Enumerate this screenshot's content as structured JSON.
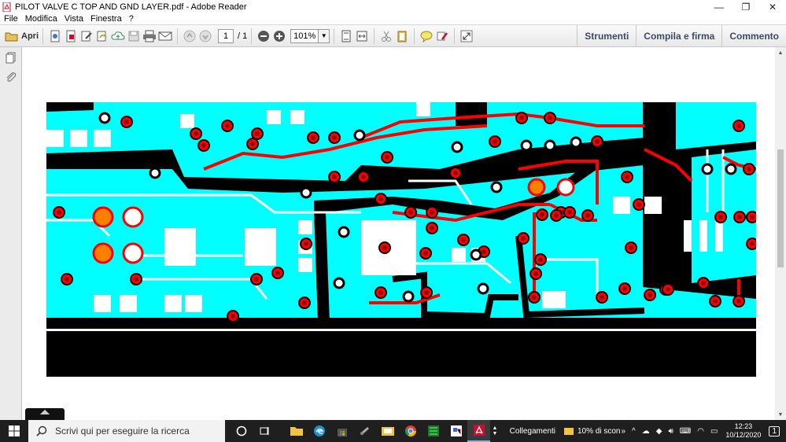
{
  "window": {
    "title": "PILOT VALVE C TOP AND GND  LAYER.pdf - Adobe Reader",
    "controls": {
      "minimize": "—",
      "maximize": "❐",
      "close": "✕"
    }
  },
  "menu": {
    "items": [
      "File",
      "Modifica",
      "Vista",
      "Finestra",
      "?"
    ]
  },
  "toolbar": {
    "open_label": "Apri",
    "page_current": "1",
    "page_total": "/ 1",
    "zoom_value": "101%",
    "right_tools": [
      "Strumenti",
      "Compila e firma",
      "Commento"
    ]
  },
  "taskbar": {
    "search_placeholder": "Scrivi qui per eseguire la ricerca",
    "links_label": "Collegamenti",
    "battery_label": "10% di scon",
    "chevron": "»",
    "time": "12:23",
    "date": "10/12/2020",
    "notification_count": "1"
  },
  "colors": {
    "pcb_cyan": "#00ffff",
    "pcb_red": "#ff0000",
    "pcb_black": "#000000",
    "adobe_red": "#c8102e",
    "taskbar": "#1f1f1f"
  }
}
